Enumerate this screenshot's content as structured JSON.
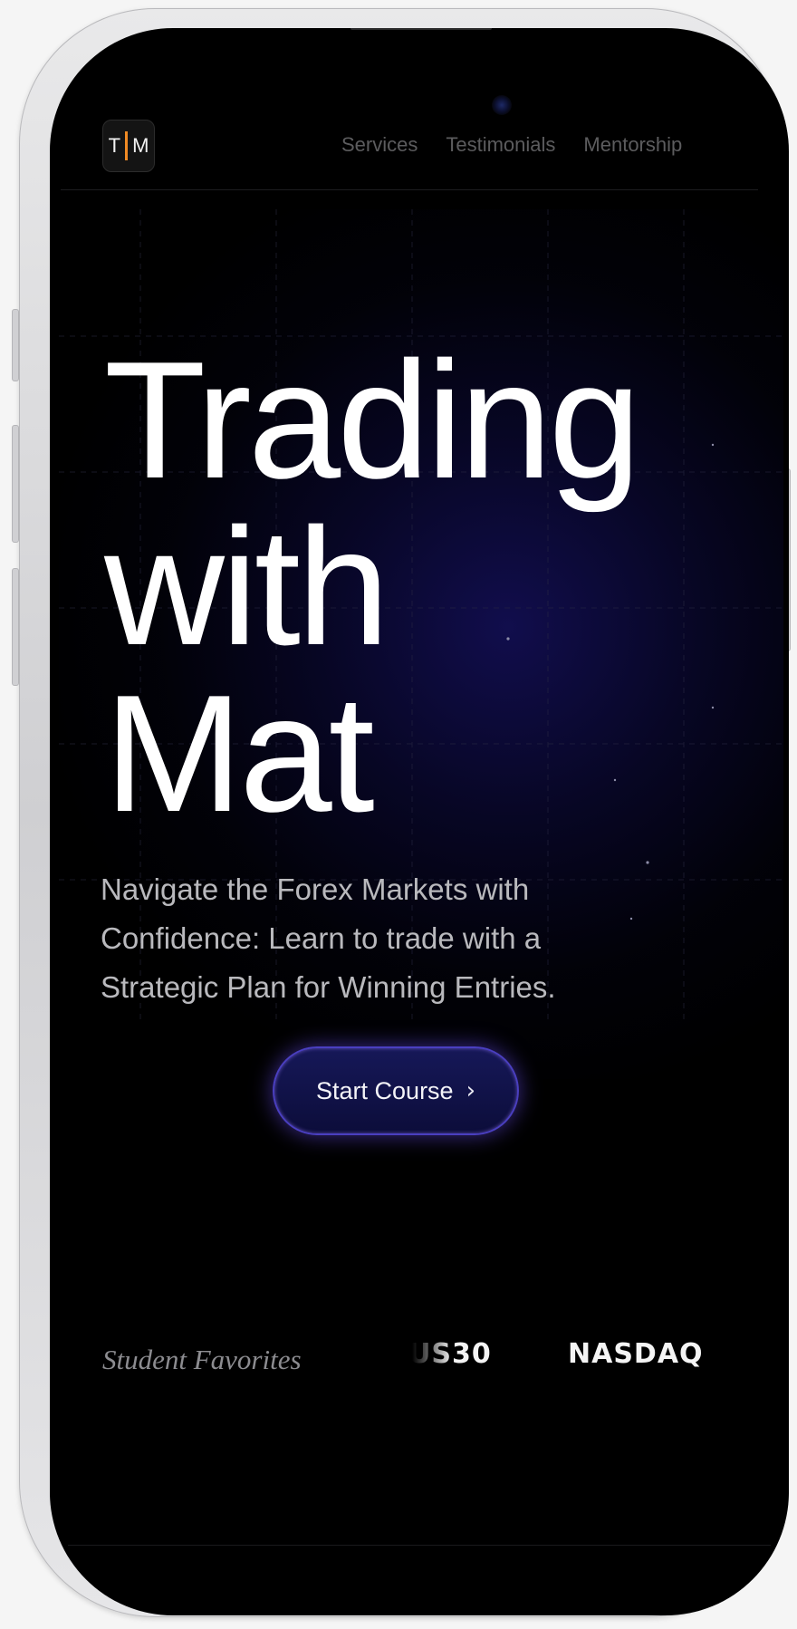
{
  "brand": {
    "logo_left": "T",
    "logo_right": "M",
    "logo_accent_color": "#f08a24"
  },
  "nav": {
    "items": [
      "Services",
      "Testimonials",
      "Mentorship"
    ]
  },
  "hero": {
    "title": "Trading\nwith\nMat",
    "subtitle": "Navigate the Forex Markets with Confidence: Learn to trade with a Strategic Plan for Winning Entries.",
    "cta_label": "Start Course",
    "cta_icon": "chevron-right-icon"
  },
  "favorites": {
    "label": "Student Favorites",
    "tickers": [
      "US30",
      "NASDAQ"
    ]
  },
  "colors": {
    "background": "#000000",
    "accent_glow": "#4a3fc0",
    "cta_fill": "#161858"
  }
}
